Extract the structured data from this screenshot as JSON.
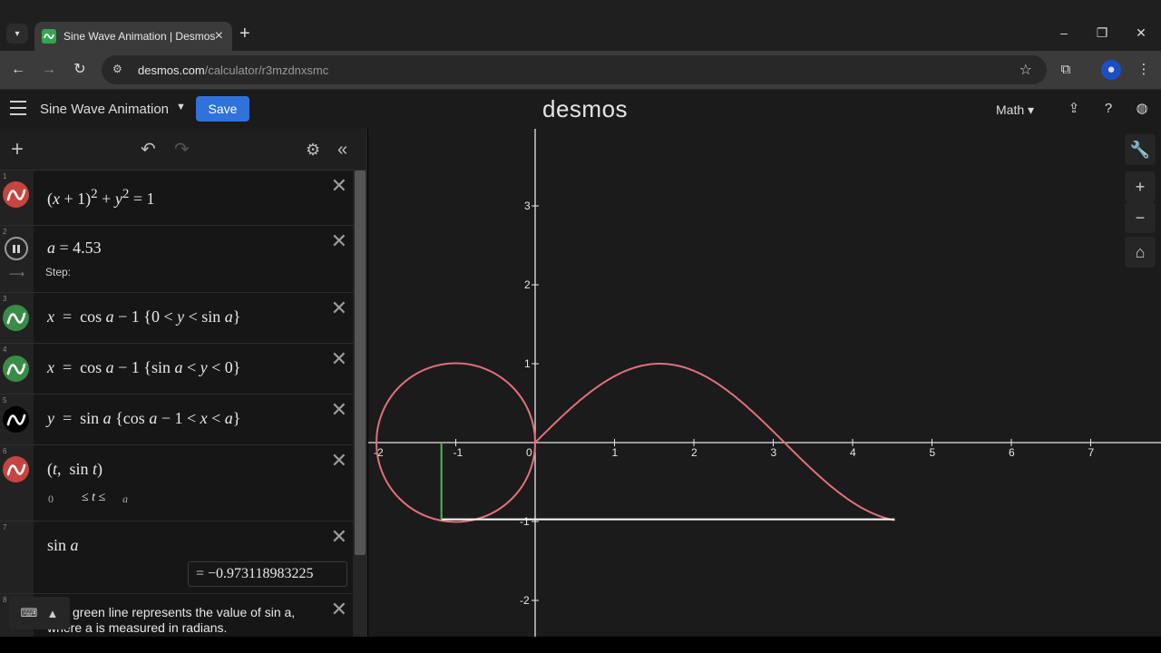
{
  "browser": {
    "tab_title": "Sine Wave Animation | Desmos",
    "url_host": "desmos.com",
    "url_path": "/calculator/r3mzdnxsmc"
  },
  "header": {
    "graph_title": "Sine Wave Animation",
    "save_label": "Save",
    "logo": "desmos",
    "math_menu": "Math"
  },
  "expressions": [
    {
      "index": "1",
      "color": "#c74440",
      "latex_html": "(<i>x</i> + 1)<sup>2</sup> + <i>y</i><sup>2</sup> = 1"
    },
    {
      "index": "2",
      "latex_html": "<i>a</i> = 4.53",
      "step_label": "Step:"
    },
    {
      "index": "3",
      "color": "#388c46",
      "latex_html": "<i>x</i> &nbsp;=&nbsp; cos <i>a</i> − 1 {0 &lt; <i>y</i> &lt; sin <i>a</i>}"
    },
    {
      "index": "4",
      "color": "#388c46",
      "latex_html": "<i>x</i> &nbsp;=&nbsp; cos <i>a</i> − 1 {sin <i>a</i> &lt; <i>y</i> &lt; 0}"
    },
    {
      "index": "5",
      "color": "#000000",
      "latex_html": "<i>y</i> &nbsp;=&nbsp; sin <i>a</i> {cos <i>a</i> − 1 &lt; <i>x</i> &lt; <i>a</i>}"
    },
    {
      "index": "6",
      "color": "#c74440",
      "latex_html": "(<i>t</i>, &nbsp;sin <i>t</i>)",
      "domain_min": "0",
      "domain_max": "a"
    },
    {
      "index": "7",
      "latex_html": "sin <i>a</i>",
      "result": "= −0.973118983225"
    },
    {
      "index": "8",
      "note": "The green line represents the value of sin a, where a is measured in radians."
    }
  ],
  "graph": {
    "x_ticks": [
      "-2",
      "-1",
      "0",
      "1",
      "2",
      "3",
      "4",
      "5",
      "6",
      "7"
    ],
    "y_ticks": [
      "3",
      "2",
      "1",
      "-1",
      "-2"
    ],
    "a": 4.53,
    "sin_a": -0.973118983225,
    "curve_color": "#e26f7a",
    "segment_color": "#4cb84c",
    "hline_color": "#ffffff"
  }
}
